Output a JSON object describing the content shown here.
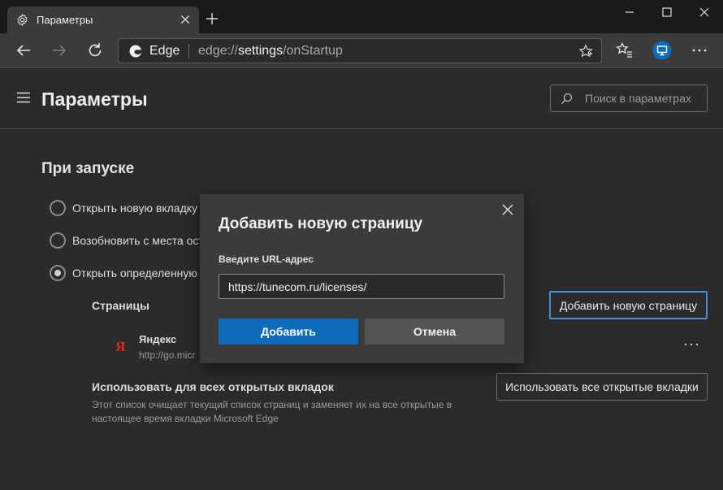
{
  "tab": {
    "title": "Параметры",
    "icon": "gear-icon",
    "close_icon": "close-icon"
  },
  "window": {
    "new_tab_icon": "plus-icon",
    "minimize_icon": "minimize-icon",
    "maximize_icon": "maximize-icon",
    "close_icon": "close-icon"
  },
  "toolbar": {
    "back_icon": "back-arrow-icon",
    "forward_icon": "forward-arrow-icon",
    "refresh_icon": "refresh-icon",
    "brand": "Edge",
    "url_scheme": "edge://",
    "url_host": "settings",
    "url_path": "/onStartup",
    "favorite_icon": "star-icon",
    "collections_icon": "favorites-list-icon",
    "profile_icon": "profile-icon",
    "menu_icon": "more-icon"
  },
  "header": {
    "title": "Параметры",
    "search_placeholder": "Поиск в параметрах"
  },
  "startup": {
    "title": "При запуске",
    "options": [
      {
        "label": "Открыть новую вкладку",
        "checked": false
      },
      {
        "label": "Возобновить с места ост",
        "checked": false
      },
      {
        "label": "Открыть определенную",
        "checked": true
      }
    ],
    "pages_label": "Страницы",
    "add_page_button": "Добавить новую страницу",
    "sites": [
      {
        "name": "Яндекс",
        "url": "http://go.micr",
        "icon": "yandex-icon"
      }
    ],
    "use_all_title": "Использовать для всех открытых вкладок",
    "use_all_desc": "Этот список очищает текущий список страниц и заменяет их на все открытые в настоящее время вкладки Microsoft Edge",
    "use_all_button": "Использовать все открытые вкладки"
  },
  "modal": {
    "title": "Добавить новую страницу",
    "url_label": "Введите URL-адрес",
    "url_value": "https://tunecom.ru/licenses/",
    "add_button": "Добавить",
    "cancel_button": "Отмена"
  },
  "colors": {
    "accent": "#0f6cbd",
    "focus_border": "#4a90d9",
    "page_bg": "#2b2b2b",
    "toolbar_bg": "#3b3b3b"
  }
}
